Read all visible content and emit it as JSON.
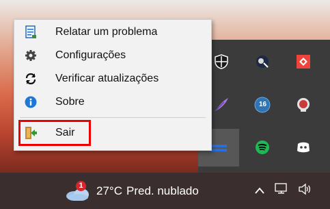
{
  "context_menu": {
    "items": [
      {
        "label": "Relatar um problema",
        "icon": "document-icon"
      },
      {
        "label": "Configurações",
        "icon": "gear-icon"
      },
      {
        "label": "Verificar atualizações",
        "icon": "refresh-icon"
      },
      {
        "label": "Sobre",
        "icon": "info-icon"
      },
      {
        "label": "Sair",
        "icon": "exit-door-icon"
      }
    ],
    "highlight_color": "#ee0000"
  },
  "tray_overflow": {
    "icons": [
      {
        "name": "shield-icon",
        "row": 0,
        "col": 0
      },
      {
        "name": "satellite-icon",
        "row": 0,
        "col": 1
      },
      {
        "name": "anydesk-icon",
        "row": 0,
        "col": 2
      },
      {
        "name": "feather-icon",
        "row": 1,
        "col": 0
      },
      {
        "name": "badge-16-icon",
        "row": 1,
        "col": 1,
        "badge": "16"
      },
      {
        "name": "red-circle-s-icon",
        "row": 1,
        "col": 2
      },
      {
        "name": "blue-bar-icon",
        "row": 2,
        "col": 0
      },
      {
        "name": "spotify-icon",
        "row": 2,
        "col": 1
      },
      {
        "name": "discord-icon",
        "row": 2,
        "col": 2
      }
    ]
  },
  "taskbar": {
    "weather": {
      "badge": "1",
      "temperature": "27°C",
      "condition": "Pred. nublado"
    },
    "system_icons": [
      "chevron-up-icon",
      "network-icon",
      "volume-icon"
    ]
  },
  "colors": {
    "taskbar_bg": "#3a2f2e",
    "tray_bg": "#3b3b3b",
    "spotify": "#1db954",
    "accent_blue": "#1e78d6"
  }
}
